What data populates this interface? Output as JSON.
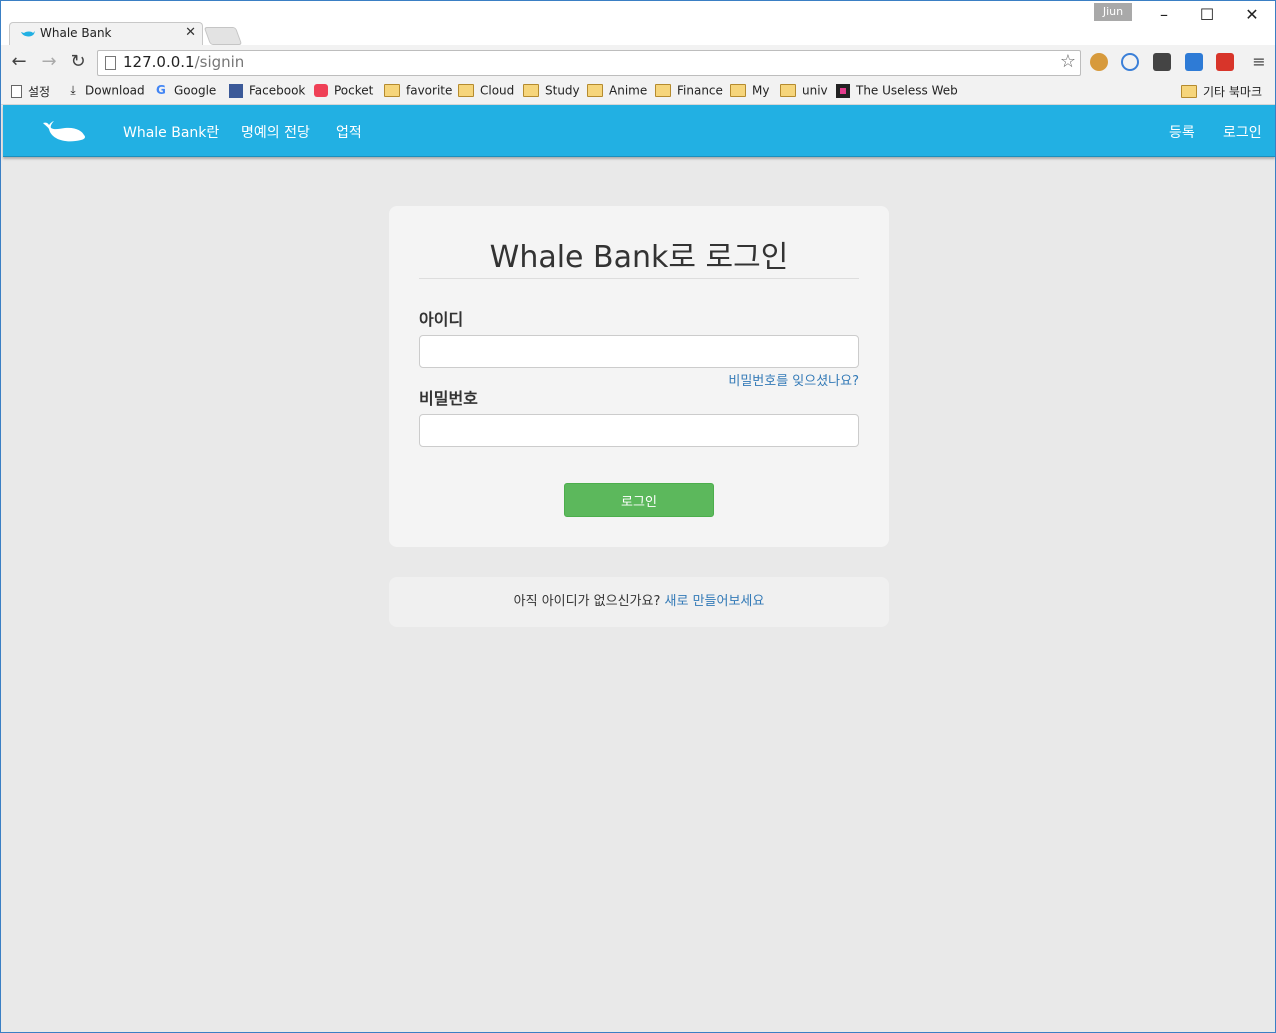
{
  "browser": {
    "profile_name": "Jiun",
    "tab_title": "Whale Bank",
    "url_host": "127.0.0.1",
    "url_path": "/signin",
    "bookmarks": [
      "설정",
      "Download",
      "Google",
      "Facebook",
      "Pocket",
      "favorite",
      "Cloud",
      "Study",
      "Anime",
      "Finance",
      "My",
      "univ",
      "The Useless Web"
    ],
    "other_bookmarks": "기타 북마크"
  },
  "navbar": {
    "brand_color": "#22b0e3",
    "links": [
      "Whale Bank란",
      "명예의 전당",
      "업적"
    ],
    "register": "등록",
    "login": "로그인"
  },
  "login_form": {
    "title": "Whale Bank로 로그인",
    "id_label": "아이디",
    "id_value": "",
    "forgot_link": "비밀번호를 잊으셨나요?",
    "password_label": "비밀번호",
    "password_value": "",
    "submit_label": "로그인",
    "submit_color": "#5cb85c"
  },
  "signup": {
    "prompt": "아직 아이디가 없으신가요?",
    "link": "새로 만들어보세요"
  }
}
